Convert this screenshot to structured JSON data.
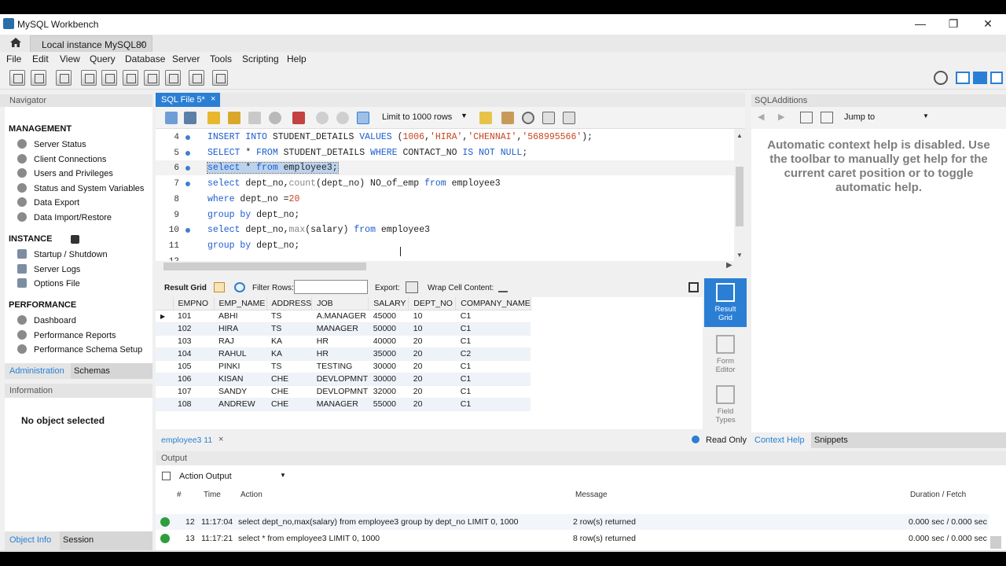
{
  "window": {
    "title": "MySQL Workbench",
    "connection_tab": "Local instance MySQL80",
    "close": "×",
    "minimize": "—",
    "maximize": "❐",
    "exit": "✕"
  },
  "menu": [
    "File",
    "Edit",
    "View",
    "Query",
    "Database",
    "Server",
    "Tools",
    "Scripting",
    "Help"
  ],
  "navigator": {
    "title": "Navigator",
    "sections": [
      {
        "title": "MANAGEMENT",
        "items": [
          "Server Status",
          "Client Connections",
          "Users and Privileges",
          "Status and System Variables",
          "Data Export",
          "Data Import/Restore"
        ]
      },
      {
        "title": "INSTANCE",
        "items": [
          "Startup / Shutdown",
          "Server Logs",
          "Options File"
        ]
      },
      {
        "title": "PERFORMANCE",
        "items": [
          "Dashboard",
          "Performance Reports",
          "Performance Schema Setup"
        ]
      }
    ],
    "tabs": [
      "Administration",
      "Schemas"
    ],
    "information_title": "Information",
    "no_object": "No object selected",
    "bottom_tabs": [
      "Object Info",
      "Session"
    ]
  },
  "editor": {
    "tab_label": "SQL File 5*",
    "limit_label": "Limit to 1000 rows",
    "lines": [
      {
        "n": "4",
        "dot": true,
        "tokens": [
          [
            "kw",
            "INSERT INTO "
          ],
          [
            "",
            "STUDENT_DETAILS "
          ],
          [
            "kw",
            "VALUES "
          ],
          [
            "",
            "("
          ],
          [
            "num",
            "1006"
          ],
          [
            "",
            ","
          ],
          [
            "str",
            "'HIRA'"
          ],
          [
            "",
            ","
          ],
          [
            "str",
            "'CHENNAI'"
          ],
          [
            "",
            ","
          ],
          [
            "str",
            "'568995566'"
          ],
          [
            "",
            ");"
          ]
        ]
      },
      {
        "n": "5",
        "dot": true,
        "tokens": [
          [
            "kw",
            "SELECT "
          ],
          [
            "",
            "* "
          ],
          [
            "kw",
            "FROM "
          ],
          [
            "",
            "STUDENT_DETAILS "
          ],
          [
            "kw",
            "WHERE "
          ],
          [
            "",
            "CONTACT_NO "
          ],
          [
            "kw",
            "IS NOT NULL"
          ],
          [
            "",
            ";"
          ]
        ]
      },
      {
        "n": "6",
        "dot": true,
        "selected": true,
        "tokens": [
          [
            "kw",
            "select "
          ],
          [
            "",
            "* "
          ],
          [
            "kw",
            "from "
          ],
          [
            "",
            "employee3;"
          ]
        ]
      },
      {
        "n": "7",
        "dot": true,
        "tokens": [
          [
            "kw",
            "select "
          ],
          [
            "",
            "dept_no,"
          ],
          [
            "fn",
            "count"
          ],
          [
            "",
            "(dept_no) NO_of_emp "
          ],
          [
            "kw",
            "from "
          ],
          [
            "",
            "employee3"
          ]
        ]
      },
      {
        "n": "8",
        "dot": false,
        "tokens": [
          [
            "kw",
            "where "
          ],
          [
            "",
            "dept_no ="
          ],
          [
            "num",
            "20"
          ]
        ]
      },
      {
        "n": "9",
        "dot": false,
        "tokens": [
          [
            "kw",
            "group by "
          ],
          [
            "",
            "dept_no;"
          ]
        ]
      },
      {
        "n": "10",
        "dot": true,
        "tokens": [
          [
            "kw",
            "select "
          ],
          [
            "",
            "dept_no,"
          ],
          [
            "fn",
            "max"
          ],
          [
            "",
            "(salary) "
          ],
          [
            "kw",
            "from "
          ],
          [
            "",
            "employee3"
          ]
        ]
      },
      {
        "n": "11",
        "dot": false,
        "tokens": [
          [
            "kw",
            "group by "
          ],
          [
            "",
            "dept_no;"
          ]
        ]
      },
      {
        "n": "12",
        "dot": false,
        "tokens": []
      }
    ]
  },
  "result": {
    "grid_label": "Result Grid",
    "filter_label": "Filter Rows:",
    "filter_value": "",
    "export_label": "Export:",
    "wrap_label": "Wrap Cell Content:",
    "columns": [
      "EMPNO",
      "EMP_NAME",
      "ADDRESS",
      "JOB",
      "SALARY",
      "DEPT_NO",
      "COMPANY_NAME"
    ],
    "rows": [
      [
        "101",
        "ABHI",
        "TS",
        "A.MANAGER",
        "45000",
        "10",
        "C1"
      ],
      [
        "102",
        "HIRA",
        "TS",
        "MANAGER",
        "50000",
        "10",
        "C1"
      ],
      [
        "103",
        "RAJ",
        "KA",
        "HR",
        "40000",
        "20",
        "C1"
      ],
      [
        "104",
        "RAHUL",
        "KA",
        "HR",
        "35000",
        "20",
        "C2"
      ],
      [
        "105",
        "PINKI",
        "TS",
        "TESTING",
        "30000",
        "20",
        "C1"
      ],
      [
        "106",
        "KISAN",
        "CHE",
        "DEVLOPMNT",
        "30000",
        "20",
        "C1"
      ],
      [
        "107",
        "SANDY",
        "CHE",
        "DEVLOPMNT",
        "32000",
        "20",
        "C1"
      ],
      [
        "108",
        "ANDREW",
        "CHE",
        "MANAGER",
        "55000",
        "20",
        "C1"
      ]
    ],
    "side_tabs": [
      {
        "line1": "Result",
        "line2": "Grid"
      },
      {
        "line1": "Form",
        "line2": "Editor"
      },
      {
        "line1": "Field",
        "line2": "Types"
      }
    ],
    "result_tab": "employee3 11",
    "read_only": "Read Only"
  },
  "output": {
    "title": "Output",
    "select_value": "Action Output",
    "headers": [
      "#",
      "Time",
      "Action",
      "Message",
      "Duration / Fetch"
    ],
    "rows": [
      {
        "num": "12",
        "time": "11:17:04",
        "action": "select dept_no,max(salary) from employee3 group by dept_no LIMIT 0, 1000",
        "message": "2 row(s) returned",
        "duration": "0.000 sec / 0.000 sec"
      },
      {
        "num": "13",
        "time": "11:17:21",
        "action": "select * from employee3 LIMIT 0, 1000",
        "message": "8 row(s) returned",
        "duration": "0.000 sec / 0.000 sec"
      }
    ]
  },
  "sqladditions": {
    "title": "SQLAdditions",
    "jump_to": "Jump to",
    "help_text": "Automatic context help is disabled. Use the toolbar to manually get help for the current caret position or to toggle automatic help.",
    "tabs": [
      "Context Help",
      "Snippets"
    ]
  },
  "colors": {
    "accent": "#2a7fd5",
    "keyword": "#1d5ccc",
    "string": "#c7441f",
    "ok": "#2e9e3d"
  }
}
